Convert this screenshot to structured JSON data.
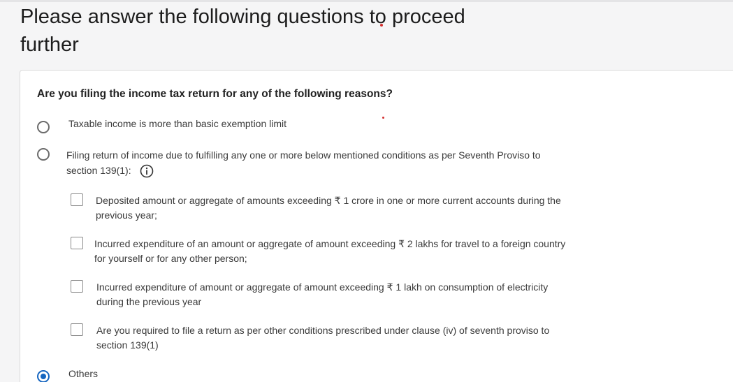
{
  "header": {
    "title": "Please answer the following questions to proceed further"
  },
  "form": {
    "question": "Are you filing the income tax return for any of the following reasons?",
    "options": [
      {
        "label": "Taxable income is more than basic exemption limit",
        "selected": false
      },
      {
        "label_line1": "Filing return of income due to fulfilling any one or more below mentioned conditions as per Seventh Proviso to",
        "label_line2": "section 139(1):",
        "icon": "info-icon",
        "selected": false,
        "conditions": [
          {
            "line1": "Deposited amount or aggregate of amounts exceeding ₹ 1 crore in one or more current accounts during the",
            "line2": "previous year;",
            "checked": false
          },
          {
            "line1": "Incurred expenditure of an amount or aggregate of amount exceeding ₹ 2 lakhs for travel to a foreign country",
            "line2": "for yourself or for any other person;",
            "checked": false
          },
          {
            "line1": "Incurred expenditure of amount or aggregate of amount exceeding ₹ 1 lakh on consumption of electricity",
            "line2": "during the previous year",
            "checked": false
          },
          {
            "line1": "Are you required to file a return as per other conditions prescribed under clause (iv) of seventh proviso to",
            "line2": "section 139(1)",
            "checked": false
          }
        ]
      },
      {
        "label": "Others",
        "selected": true
      }
    ]
  },
  "colors": {
    "accent": "#1565c0",
    "radio_border": "#6b6b6b",
    "background": "#f5f5f6"
  }
}
